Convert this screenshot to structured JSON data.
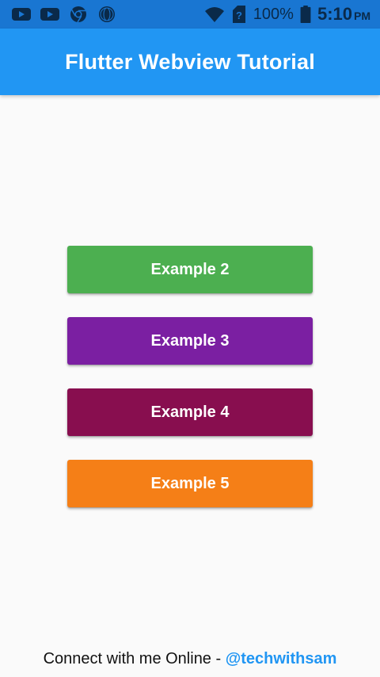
{
  "status_bar": {
    "icons_left": [
      "youtube-icon",
      "youtube-icon",
      "chrome-icon",
      "globe-icon"
    ],
    "icons_right": [
      "wifi-icon",
      "sim-unknown-icon",
      "battery-icon"
    ],
    "battery_percent": "100%",
    "time": "5:10",
    "time_suffix": "PM",
    "colors": {
      "background": "#1976D2",
      "icon": "#0a2a4a"
    }
  },
  "app_bar": {
    "title": "Flutter Webview Tutorial",
    "color": "#2196F3"
  },
  "buttons": [
    {
      "label": "Example 2",
      "color": "#4CAF50"
    },
    {
      "label": "Example 3",
      "color": "#7B1FA2"
    },
    {
      "label": "Example 4",
      "color": "#880E4F"
    },
    {
      "label": "Example 5",
      "color": "#F57F17"
    }
  ],
  "footer": {
    "text": "Connect with me Online - ",
    "link": "@techwithsam",
    "link_color": "#2196F3"
  }
}
